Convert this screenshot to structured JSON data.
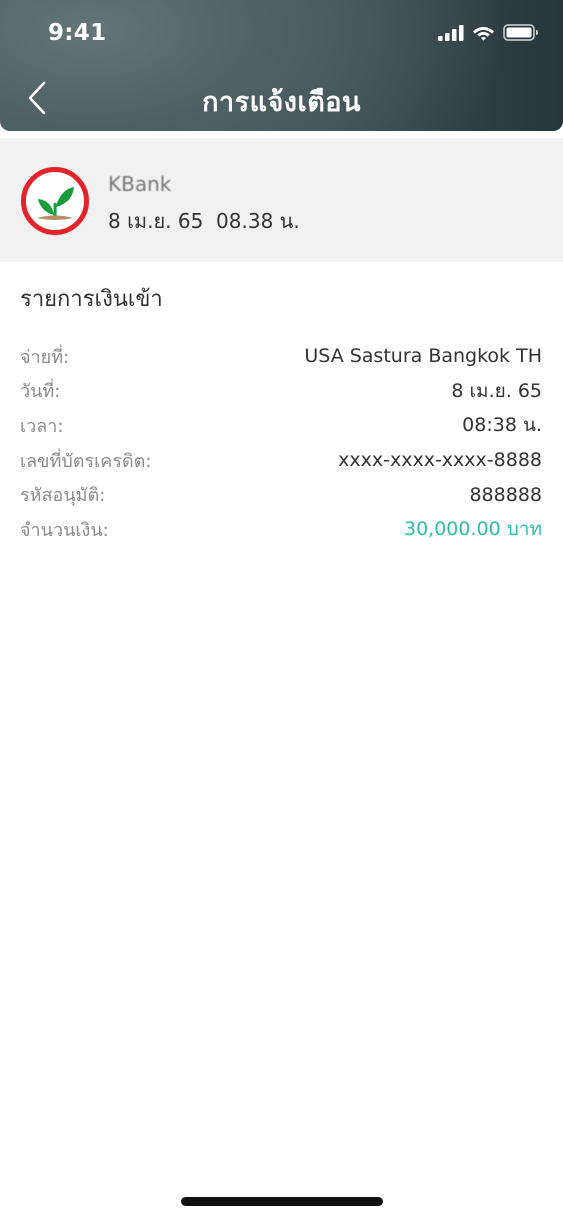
{
  "status_bar": {
    "time": "9:41",
    "icons": [
      "cellular-signal-icon",
      "wifi-icon",
      "battery-icon"
    ]
  },
  "nav": {
    "title": "การแจ้งเตือน",
    "back_icon": "chevron-left-icon"
  },
  "sender": {
    "name": "KBank",
    "datetime": "8 เม.ย. 65  08.38 น.",
    "logo_icon": "kbank-logo"
  },
  "transaction": {
    "title": "รายการเงินเข้า",
    "rows": [
      {
        "label": "จ่ายที่:",
        "value": "USA Sastura Bangkok TH"
      },
      {
        "label": "วันที่:",
        "value": "8 เม.ย. 65"
      },
      {
        "label": "เวลา:",
        "value": "08:38 น."
      },
      {
        "label": "เลขที่บัตรเครดิต:",
        "value": "xxxx-xxxx-xxxx-8888"
      },
      {
        "label": "รหัสอนุมัติ:",
        "value": "888888"
      },
      {
        "label": "จำนวนเงิน:",
        "value": "30,000.00 บาท"
      }
    ]
  },
  "colors": {
    "header_dark": "#27353c",
    "header_light": "#647575",
    "card_background": "#f1f1f1",
    "amount": "#2dbfa6",
    "logo_red": "#e3232a",
    "logo_green": "#1a9c3e"
  }
}
